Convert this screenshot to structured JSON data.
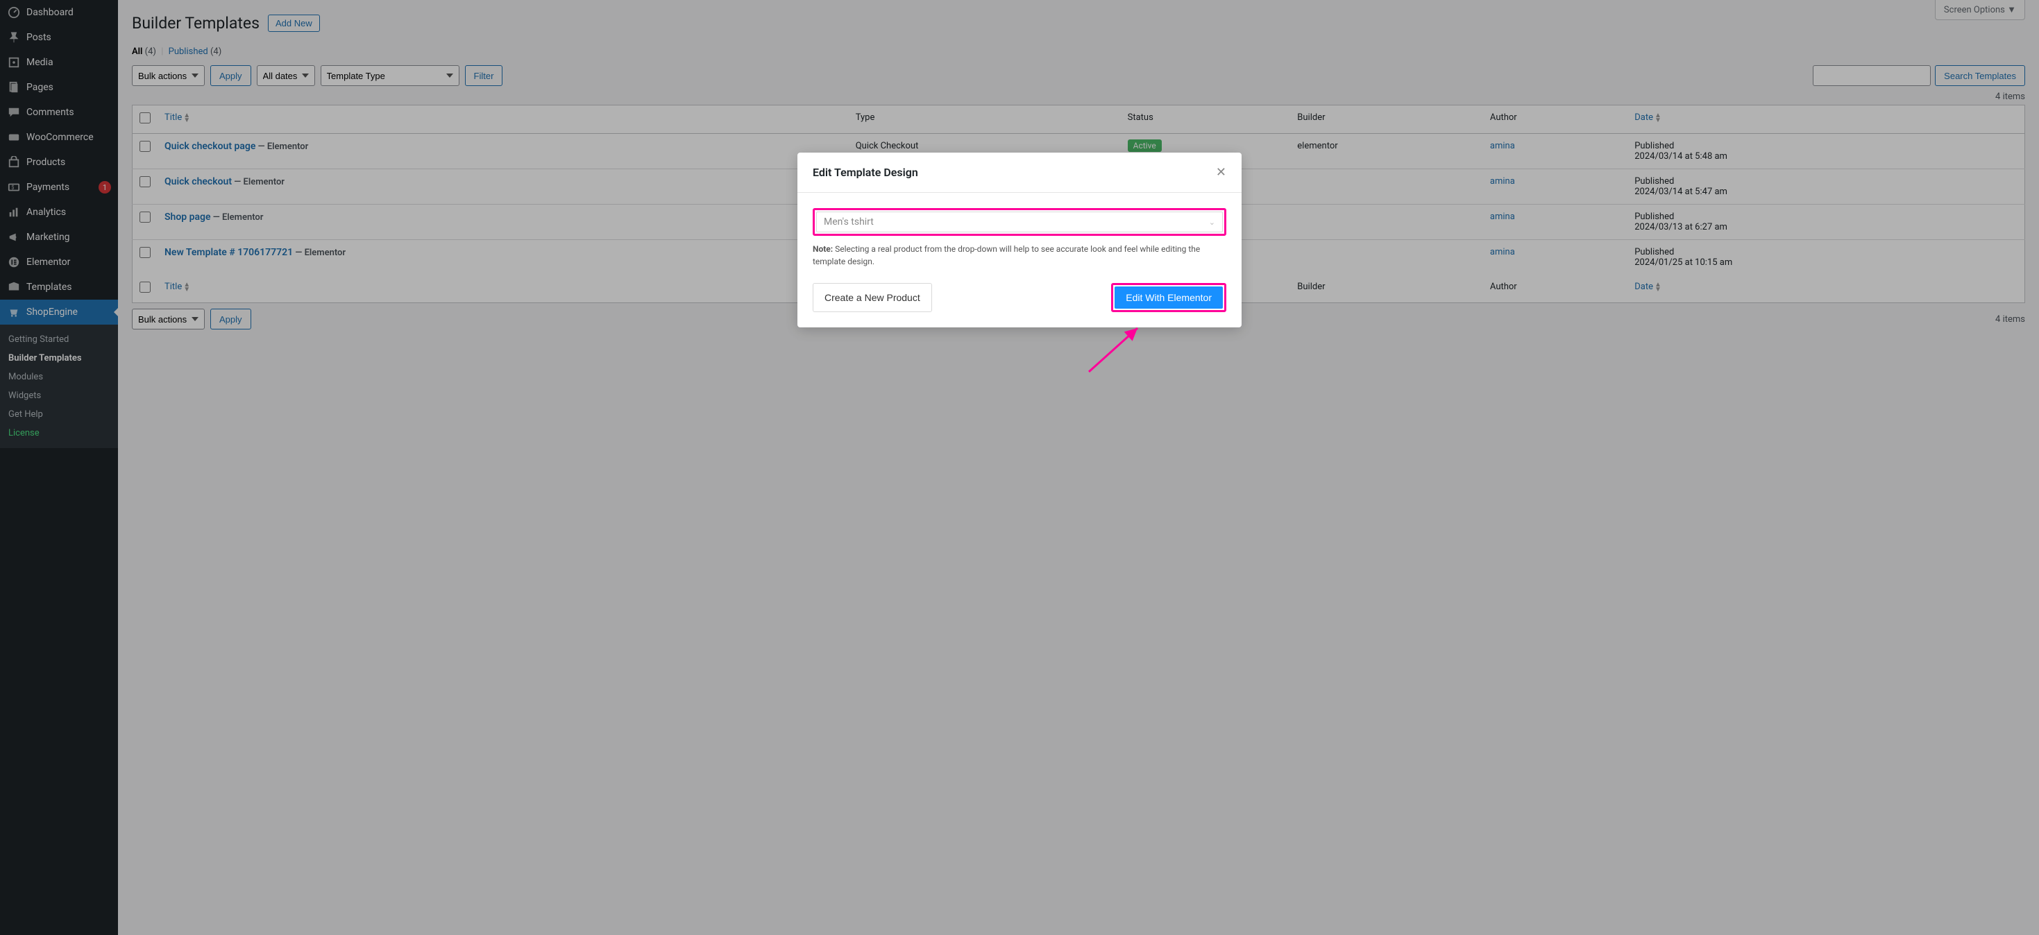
{
  "sidebar": {
    "items": [
      {
        "label": "Dashboard",
        "icon": "dashboard"
      },
      {
        "label": "Posts",
        "icon": "pin"
      },
      {
        "label": "Media",
        "icon": "media"
      },
      {
        "label": "Pages",
        "icon": "pages"
      },
      {
        "label": "Comments",
        "icon": "comments"
      },
      {
        "label": "WooCommerce",
        "icon": "woo"
      },
      {
        "label": "Products",
        "icon": "products"
      },
      {
        "label": "Payments",
        "icon": "payments",
        "badge": "1"
      },
      {
        "label": "Analytics",
        "icon": "analytics"
      },
      {
        "label": "Marketing",
        "icon": "marketing"
      },
      {
        "label": "Elementor",
        "icon": "elementor"
      },
      {
        "label": "Templates",
        "icon": "templates"
      },
      {
        "label": "ShopEngine",
        "icon": "shopengine",
        "active": true
      }
    ],
    "subs": [
      {
        "label": "Getting Started"
      },
      {
        "label": "Builder Templates",
        "active": true
      },
      {
        "label": "Modules"
      },
      {
        "label": "Widgets"
      },
      {
        "label": "Get Help"
      },
      {
        "label": "License",
        "license": true
      }
    ]
  },
  "header": {
    "screen_options": "Screen Options",
    "title": "Builder Templates",
    "add_new": "Add New"
  },
  "views": {
    "all_label": "All",
    "all_count": "(4)",
    "published_label": "Published",
    "published_count": "(4)"
  },
  "filters": {
    "bulk": "Bulk actions",
    "apply": "Apply",
    "dates": "All dates",
    "template_type": "Template Type",
    "filter": "Filter",
    "items_count": "4 items",
    "search_btn": "Search Templates"
  },
  "columns": {
    "title": "Title",
    "type": "Type",
    "status": "Status",
    "builder": "Builder",
    "author": "Author",
    "date": "Date"
  },
  "rows": [
    {
      "title": "Quick checkout page",
      "suffix": " — Elementor",
      "type": "Quick Checkout",
      "status": "Active",
      "builder": "elementor",
      "author": "amina",
      "date_label": "Published",
      "date": "2024/03/14 at 5:48 am"
    },
    {
      "title": "Quick checkout",
      "suffix": " — Elementor",
      "type": "",
      "status": "",
      "builder": "",
      "author": "amina",
      "date_label": "Published",
      "date": "2024/03/14 at 5:47 am"
    },
    {
      "title": "Shop page",
      "suffix": " — Elementor",
      "type": "",
      "status": "",
      "builder": "",
      "author": "amina",
      "date_label": "Published",
      "date": "2024/03/13 at 6:27 am"
    },
    {
      "title": "New Template # 1706177721",
      "suffix": " — Elementor",
      "type": "",
      "status": "",
      "builder": "",
      "author": "amina",
      "date_label": "Published",
      "date": "2024/01/25 at 10:15 am"
    }
  ],
  "modal": {
    "title": "Edit Template Design",
    "product_placeholder": "Men's tshirt",
    "note_label": "Note:",
    "note_text": " Selecting a real product from the drop-down will help to see accurate look and feel while editing the template design.",
    "create_btn": "Create a New Product",
    "edit_btn": "Edit With Elementor"
  }
}
